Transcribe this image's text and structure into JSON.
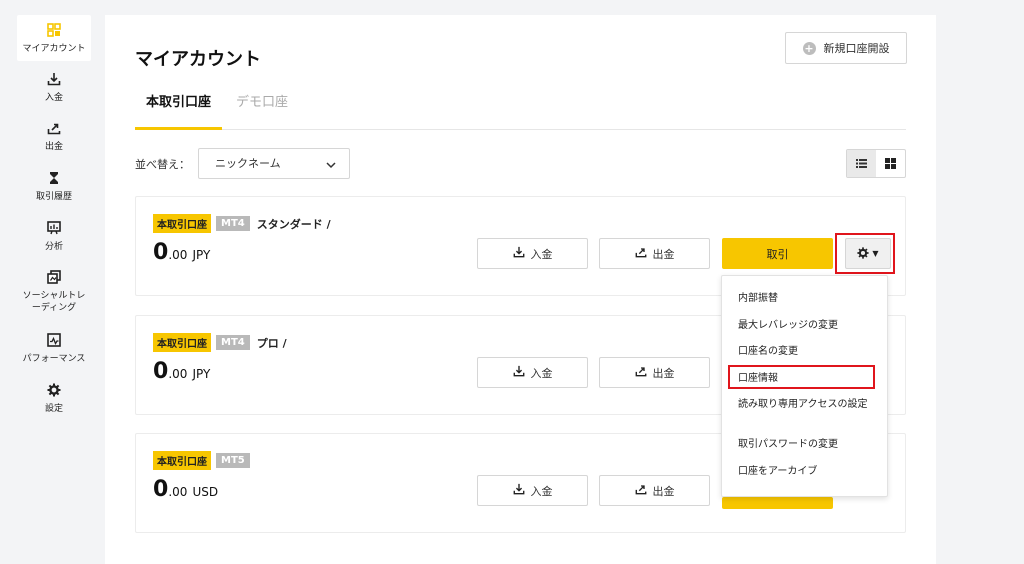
{
  "sidebar": {
    "items": [
      {
        "label": "マイアカウント",
        "icon": "account-grid-icon",
        "active": true
      },
      {
        "label": "入金",
        "icon": "download-icon"
      },
      {
        "label": "出金",
        "icon": "upload-icon"
      },
      {
        "label": "取引履歴",
        "icon": "hourglass-icon"
      },
      {
        "label": "分析",
        "icon": "analysis-icon"
      },
      {
        "label": "ソーシャルトレーディング",
        "label_line1": "ソーシャルトレ",
        "label_line2": "ーディング",
        "icon": "social-trading-icon"
      },
      {
        "label": "パフォーマンス",
        "icon": "performance-chart-icon"
      },
      {
        "label": "設定",
        "icon": "gear-icon"
      }
    ]
  },
  "header": {
    "title": "マイアカウント",
    "new_account_label": "新規口座開設"
  },
  "tabs": [
    {
      "label": "本取引口座",
      "active": true
    },
    {
      "label": "デモ口座",
      "active": false
    }
  ],
  "toolbar": {
    "sort_label": "並べ替え：",
    "sort_value": "ニックネーム"
  },
  "accounts": [
    {
      "type_badge": "本取引口座",
      "platform": "MT4",
      "name": "スタンダード /",
      "balance_int": "0",
      "balance_dec": ".00",
      "currency": "JPY"
    },
    {
      "type_badge": "本取引口座",
      "platform": "MT4",
      "name": "プロ /",
      "balance_int": "0",
      "balance_dec": ".00",
      "currency": "JPY"
    },
    {
      "type_badge": "本取引口座",
      "platform": "MT5",
      "name": "",
      "balance_int": "0",
      "balance_dec": ".00",
      "currency": "USD"
    }
  ],
  "actions": {
    "deposit_label": "入金",
    "withdraw_label": "出金",
    "trade_label": "取引"
  },
  "account_menu": {
    "items": [
      "内部振替",
      "最大レバレッジの変更",
      "口座名の変更",
      "口座情報",
      "読み取り専用アクセスの設定",
      "取引パスワードの変更",
      "口座をアーカイブ"
    ],
    "highlighted": "口座情報"
  },
  "colors": {
    "accent": "#f7c600",
    "highlight_border": "#e0151c",
    "badge_gray": "#b9b9b9",
    "background": "#f3f4f6"
  }
}
